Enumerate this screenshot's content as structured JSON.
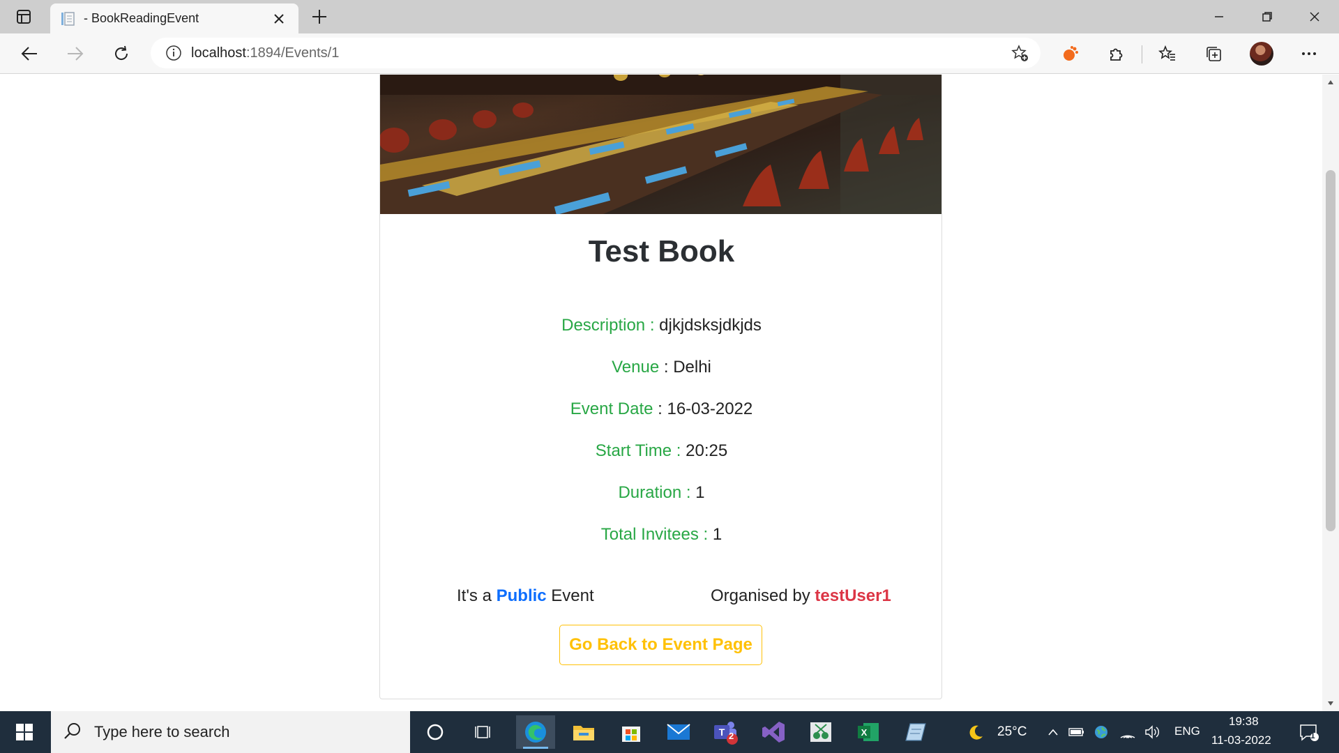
{
  "browser": {
    "tab_title": "- BookReadingEvent",
    "url_host": "localhost",
    "url_rest": ":1894/Events/1"
  },
  "event": {
    "title": "Test Book",
    "details": [
      {
        "label": "Description :",
        "value": " djkjdsksjdkjds"
      },
      {
        "label": "Venue",
        "value": " : Delhi"
      },
      {
        "label": "Event Date",
        "value": " : 16-03-2022"
      },
      {
        "label": "Start Time :",
        "value": " 20:25"
      },
      {
        "label": "Duration :",
        "value": " 1"
      },
      {
        "label": "Total Invitees :",
        "value": " 1"
      }
    ],
    "public_prefix": "It's a ",
    "public_type": "Public",
    "public_suffix": " Event",
    "organiser_prefix": "Organised by ",
    "organiser_name": "testUser1",
    "back_button": "Go Back to Event Page"
  },
  "taskbar": {
    "search_placeholder": "Type here to search",
    "teams_badge": "2",
    "weather": "25°C",
    "language": "ENG",
    "time": "19:38",
    "date": "11-03-2022",
    "notification_count": "1"
  },
  "colors": {
    "label_green": "#28a745",
    "public_blue": "#0d6efd",
    "organiser_red": "#dc3545",
    "button_yellow": "#ffc107"
  }
}
